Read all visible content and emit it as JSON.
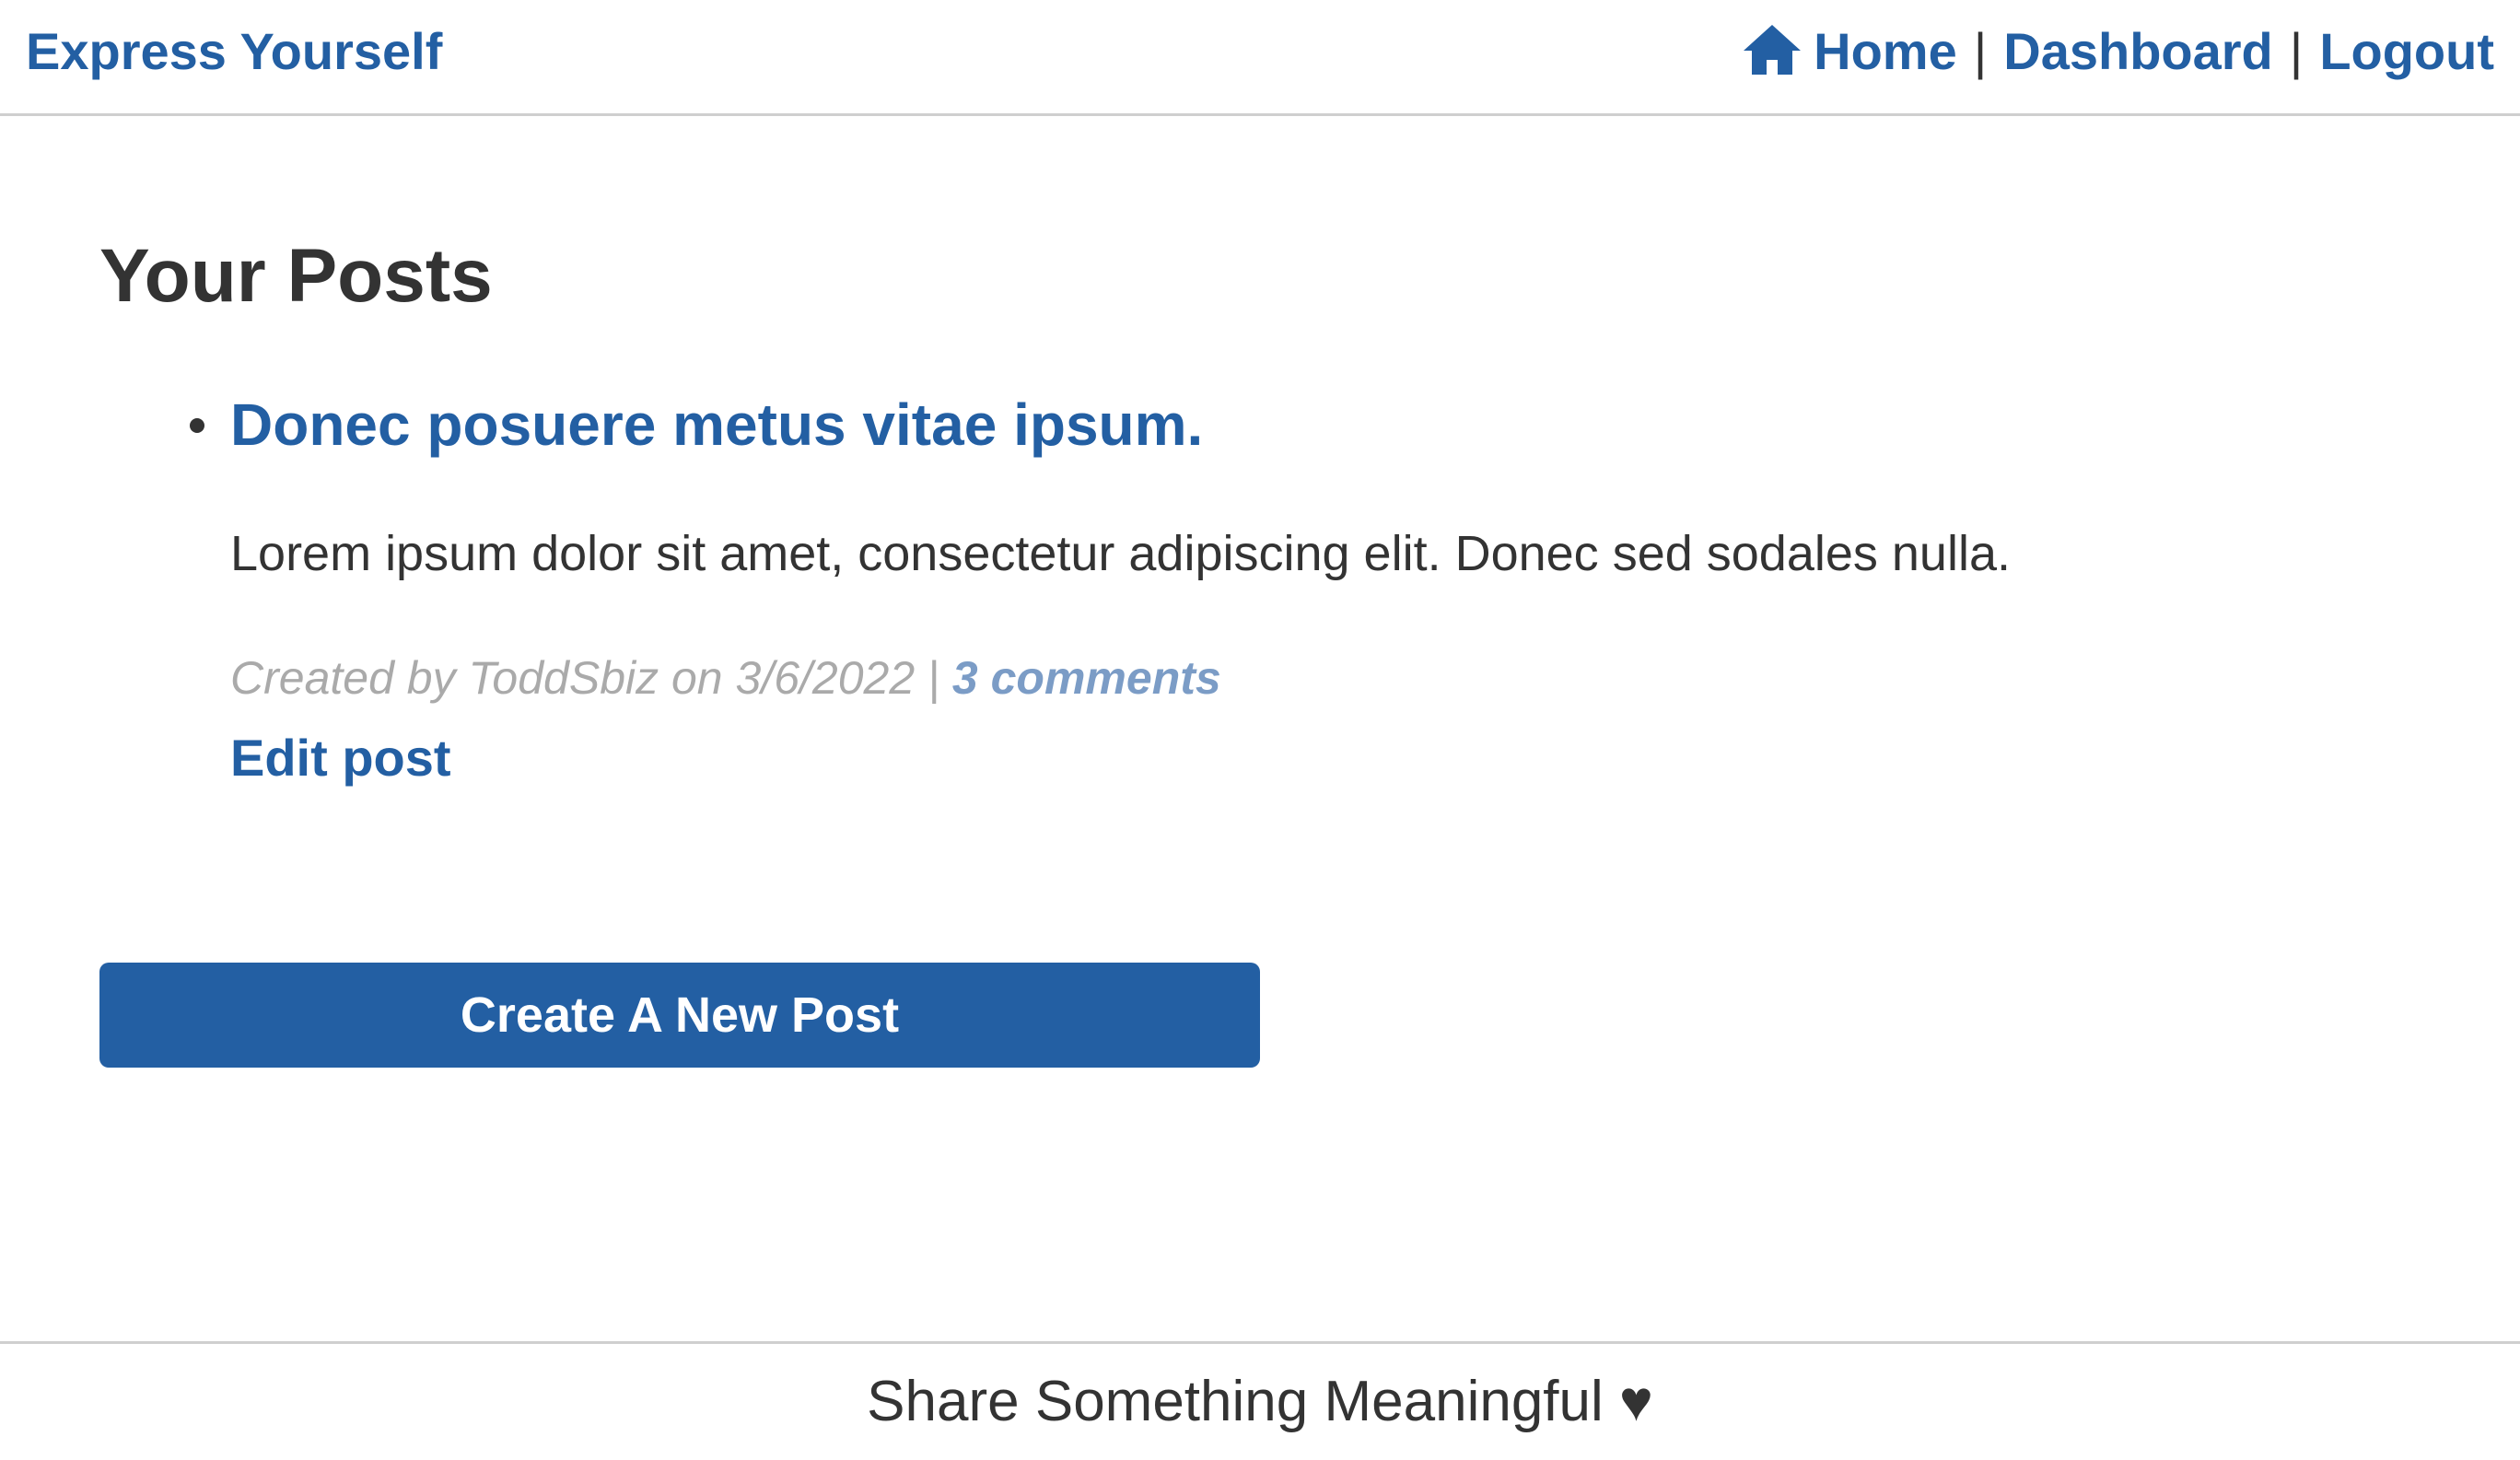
{
  "header": {
    "brand": "Express Yourself",
    "nav": {
      "home_label": "Home",
      "dashboard_label": "Dashboard",
      "logout_label": "Logout",
      "separator": "|"
    }
  },
  "main": {
    "title": "Your Posts",
    "posts": [
      {
        "title": "Donec posuere metus vitae ipsum.",
        "body": "Lorem ipsum dolor sit amet, consectetur adipiscing elit. Donec sed sodales nulla.",
        "meta_prefix": "Created by ToddSbiz on 3/6/2022 | ",
        "comments_label": "3 comments",
        "edit_label": "Edit post"
      }
    ],
    "create_button_label": "Create A New Post"
  },
  "footer": {
    "text": "Share Something Meaningful ♥"
  },
  "colors": {
    "accent": "#235fa3",
    "text": "#333333",
    "muted": "#aaaaaa",
    "link_muted": "#7b9cc6",
    "border": "#cfcfcf"
  },
  "icons": {
    "home": "home-icon"
  }
}
